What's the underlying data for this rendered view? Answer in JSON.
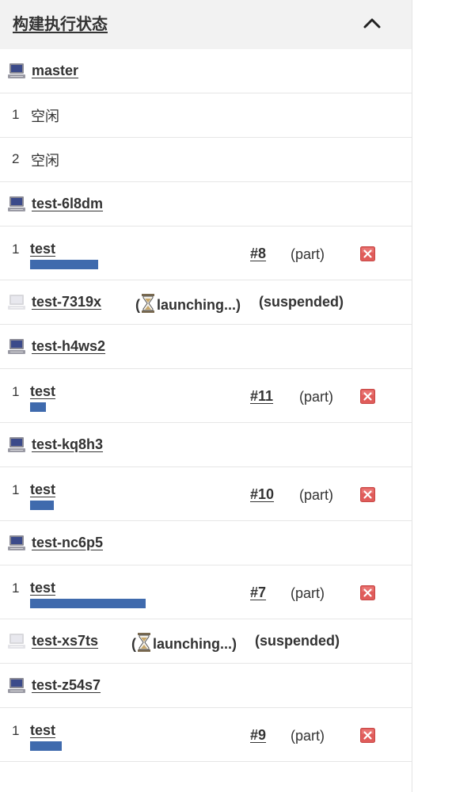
{
  "header": {
    "title": "构建执行状态",
    "collapse_icon": "chevron-up-icon"
  },
  "colors": {
    "progress": "#3f6aad",
    "stop": "#d9534f",
    "header_bg": "#f2f2f2"
  },
  "nodes": [
    {
      "name": "master",
      "offline": false,
      "executors": [
        {
          "num": "1",
          "status": "空闲"
        },
        {
          "num": "2",
          "status": "空闲"
        }
      ]
    },
    {
      "name": "test-6l8dm",
      "offline": false,
      "executors": [
        {
          "num": "1",
          "job": "test",
          "build": "#8",
          "part": "(part)",
          "progress": 0.26
        }
      ]
    },
    {
      "name": "test-7319x",
      "offline": true,
      "launching": "launching...)",
      "launching_open": "(",
      "suspended": "(suspended)"
    },
    {
      "name": "test-h4ws2",
      "offline": false,
      "executors": [
        {
          "num": "1",
          "job": "test",
          "build": "#11",
          "part": "(part)",
          "progress": 0.06
        }
      ]
    },
    {
      "name": "test-kq8h3",
      "offline": false,
      "executors": [
        {
          "num": "1",
          "job": "test",
          "build": "#10",
          "part": "(part)",
          "progress": 0.09
        }
      ]
    },
    {
      "name": "test-nc6p5",
      "offline": false,
      "executors": [
        {
          "num": "1",
          "job": "test",
          "build": "#7",
          "part": "(part)",
          "progress": 0.44
        }
      ]
    },
    {
      "name": "test-xs7ts",
      "offline": true,
      "launching": "launching...)",
      "launching_open": "(",
      "suspended": "(suspended)"
    },
    {
      "name": "test-z54s7",
      "offline": false,
      "executors": [
        {
          "num": "1",
          "job": "test",
          "build": "#9",
          "part": "(part)",
          "progress": 0.12
        }
      ]
    }
  ]
}
